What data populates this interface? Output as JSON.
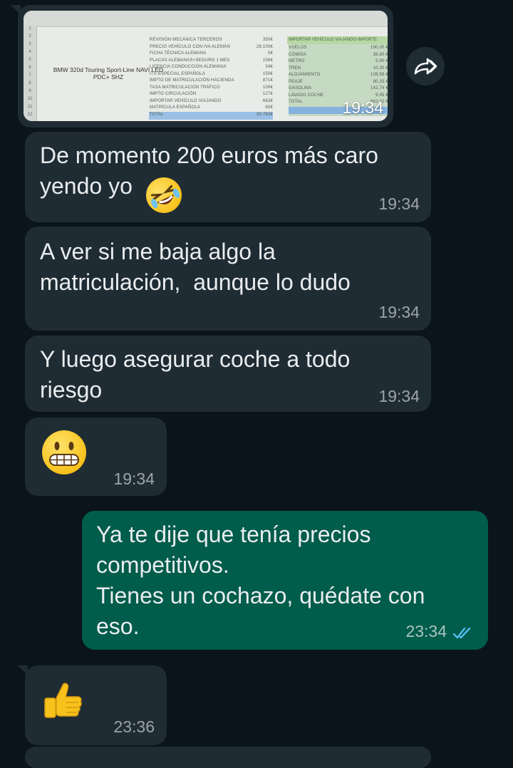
{
  "screenshot": {
    "sheet": {
      "car_label": "BMW 320d Touring Sport-Line NAVI LED PDC+ SHZ",
      "items": [
        {
          "label": "REVISIÓN MECÁNICA TERCEROS",
          "value": "350€"
        },
        {
          "label": "PRECIO VEHÍCULO CON IVA ALEMÁN",
          "value": "28.100€"
        },
        {
          "label": "FICHA TÉCNICA ALEMANA",
          "value": "0€"
        },
        {
          "label": "PLACAS ALEMANAS+SEGURO 1 MES",
          "value": "156€"
        },
        {
          "label": "LICENCIA CONDUCCIÓN ALEMANIA",
          "value": "34€"
        },
        {
          "label": "ITV ESPECIAL ESPAÑOLA",
          "value": "150€"
        },
        {
          "label": "IMPTO DE MATRICULACIÓN HACIENDA",
          "value": "871€"
        },
        {
          "label": "TASA MATRICULACIÓN TRÁFICO",
          "value": "100€"
        },
        {
          "label": "IMPTO CIRCULACIÓN",
          "value": "127€"
        },
        {
          "label": "IMPORTAR VEHÍCULO VIAJANDO",
          "value": "662€"
        },
        {
          "label": "MATRÍCULA ESPAÑOLA",
          "value": "60€"
        },
        {
          "label": "TOTAL",
          "value": "30.760€"
        }
      ],
      "trip_header": "IMPORTAR VEHÍCULO VIAJANDO   IMPORTE",
      "trip_items": [
        {
          "label": "VUELOS",
          "value": "190,00 €"
        },
        {
          "label": "COMIDA",
          "value": "38,80 €"
        },
        {
          "label": "METRO",
          "value": "5,90 €"
        },
        {
          "label": "TREN",
          "value": "10,30 €"
        },
        {
          "label": "ALOJAMIENTO",
          "value": "108,58 €"
        },
        {
          "label": "PEAJE",
          "value": "80,15 €"
        },
        {
          "label": "GASOLINA",
          "value": "142,74 €"
        },
        {
          "label": "LAVADO COCHE",
          "value": "9,95 €"
        },
        {
          "label": "TOTAL",
          "value": "662,02 €"
        }
      ]
    },
    "time": "19:34"
  },
  "messages": [
    {
      "text": "De momento 200 euros más caro\nyendo yo",
      "emoji": "rolling-on-floor-laughing",
      "time": "19:34"
    },
    {
      "text": "A ver si me baja algo la\nmatriculación,  aunque lo dudo",
      "time": "19:34"
    },
    {
      "text": "Y luego asegurar coche a todo\nriesgo",
      "time": "19:34"
    },
    {
      "emoji": "grimacing-face",
      "time": "19:34"
    },
    {
      "text": "Ya te dije que tenía precios\ncompetitivos.\nTienes un cochazo, quédate con\neso.",
      "time": "23:34",
      "status": "read"
    },
    {
      "emoji": "thumbs-up",
      "time": "23:36"
    }
  ],
  "colors": {
    "background": "#0b141a",
    "incoming_bubble": "#202c33",
    "outgoing_bubble": "#005c4b",
    "read_ticks": "#53bdeb"
  },
  "icons": {
    "forward": "forward-icon",
    "read_receipt": "double-check-icon"
  }
}
